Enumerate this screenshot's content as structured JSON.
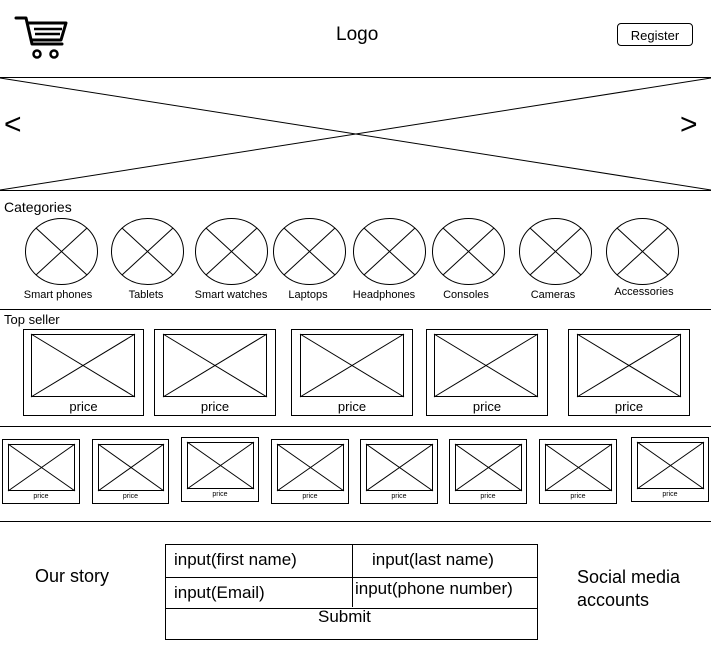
{
  "header": {
    "logo_text": "Logo",
    "register_label": "Register",
    "cart_icon": "shopping-cart-icon"
  },
  "carousel": {
    "prev_label": "<",
    "next_label": ">"
  },
  "categories": {
    "heading": "Categories",
    "items": [
      {
        "label": "Smart phones"
      },
      {
        "label": "Tablets"
      },
      {
        "label": "Smart watches"
      },
      {
        "label": "Laptops"
      },
      {
        "label": "Headphones"
      },
      {
        "label": "Consoles"
      },
      {
        "label": "Cameras"
      },
      {
        "label": "Accessories"
      }
    ]
  },
  "top_seller": {
    "heading": "Top seller",
    "products": [
      {
        "price": "price"
      },
      {
        "price": "price"
      },
      {
        "price": "price"
      },
      {
        "price": "price"
      },
      {
        "price": "price"
      }
    ]
  },
  "more_products": {
    "products": [
      {
        "price": "price"
      },
      {
        "price": "price"
      },
      {
        "price": "price"
      },
      {
        "price": "price"
      },
      {
        "price": "price"
      },
      {
        "price": "price"
      },
      {
        "price": "price"
      },
      {
        "price": "price"
      }
    ]
  },
  "footer": {
    "our_story": "Our story",
    "social_media": "Social media accounts",
    "form": {
      "first_name": "input(first name)",
      "last_name": "input(last name)",
      "email": "input(Email)",
      "phone": "input(phone number)",
      "submit": "Submit"
    }
  }
}
